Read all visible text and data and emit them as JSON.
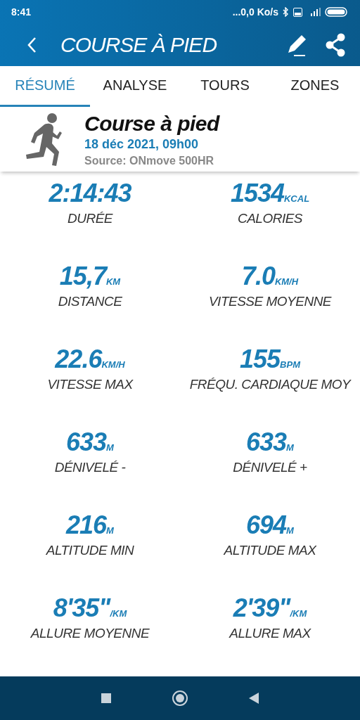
{
  "status_bar": {
    "time": "8:41",
    "network_speed": "...0,0 Ko/s"
  },
  "app_bar": {
    "title": "COURSE À PIED"
  },
  "tabs": [
    {
      "label": "RÉSUMÉ",
      "selected": true
    },
    {
      "label": "ANALYSE",
      "selected": false
    },
    {
      "label": "TOURS",
      "selected": false
    },
    {
      "label": "ZONES",
      "selected": false
    }
  ],
  "activity": {
    "name": "Course à pied",
    "date": "18 déc 2021, 09h00",
    "source": "Source: ONmove 500HR"
  },
  "stats": [
    {
      "value": "2:14:43",
      "label": "DURÉE"
    },
    {
      "value": "1534",
      "unit": "KCAL",
      "label": "CALORIES"
    },
    {
      "value": "15,7",
      "unit": "KM",
      "label": "DISTANCE"
    },
    {
      "value": "7.0",
      "unit": "KM/H",
      "label": "VITESSE MOYENNE"
    },
    {
      "value": "22.6",
      "unit": "KM/H",
      "label": "VITESSE MAX"
    },
    {
      "value": "155",
      "unit": "BPM",
      "label": "FRÉQU. CARDIAQUE MOY"
    },
    {
      "value": "633",
      "unit": "M",
      "label": "DÉNIVELÉ -"
    },
    {
      "value": "633",
      "unit": "M",
      "label": "DÉNIVELÉ +"
    },
    {
      "value": "216",
      "unit": "M",
      "label": "ALTITUDE MIN"
    },
    {
      "value": "694",
      "unit": "M",
      "label": "ALTITUDE MAX"
    },
    {
      "value": "8'35\"",
      "unit": "/KM",
      "label": "ALLURE MOYENNE"
    },
    {
      "value": "2'39\"",
      "unit": "/KM",
      "label": "ALLURE MAX"
    }
  ]
}
